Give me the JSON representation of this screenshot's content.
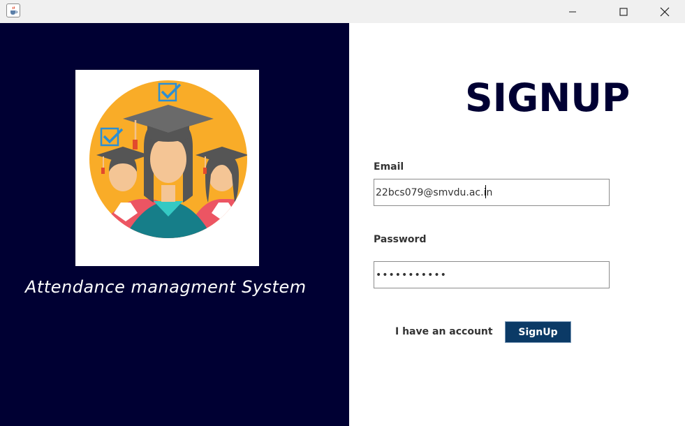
{
  "window": {
    "icons": {
      "app": "java-cup-icon",
      "minimize": "minimize-icon",
      "maximize": "maximize-icon",
      "close": "close-icon"
    }
  },
  "left_panel": {
    "logo_icon": "graduates-icon",
    "tagline": "Attendance managment System",
    "background_color": "#000033"
  },
  "form": {
    "heading": "SIGNUP",
    "email_label": "Email",
    "email_value": "22bcs079@smvdu.ac.in",
    "password_label": "Password",
    "password_value": "•••••••••••",
    "account_link": "I have an account",
    "submit_label": "SignUp",
    "accent_color": "#0b3a66"
  }
}
